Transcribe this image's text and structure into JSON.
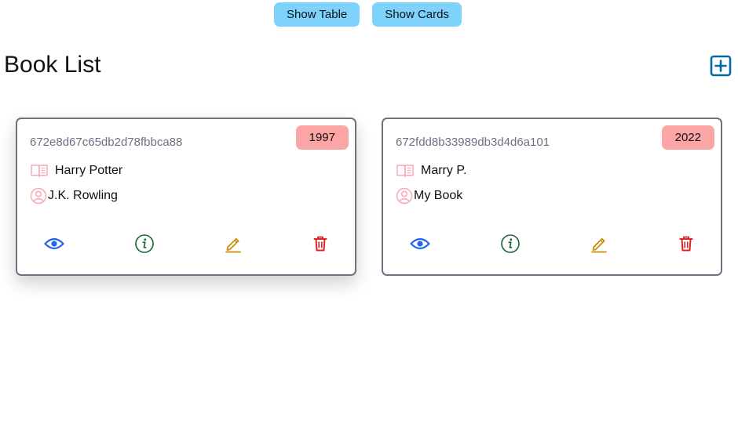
{
  "toolbar": {
    "show_table_label": "Show Table",
    "show_cards_label": "Show Cards"
  },
  "page": {
    "title": "Book List",
    "add_icon": "plus-square-icon"
  },
  "books": [
    {
      "id": "672e8d67c65db2d78fbbca88",
      "year": "1997",
      "title": "Harry Potter",
      "author": "J.K. Rowling"
    },
    {
      "id": "672fdd8b33989db3d4d6a101",
      "year": "2022",
      "title": "Marry P.",
      "author": "My Book"
    }
  ],
  "icons": {
    "title": "book-open-icon",
    "author": "user-circle-icon",
    "view": "eye-icon",
    "info": "info-circle-icon",
    "edit": "pencil-icon",
    "delete": "trash-icon"
  },
  "colors": {
    "toggle_button": "#7dd3fc",
    "year_badge": "#fca5a5",
    "add_icon": "#0369a1",
    "row_icon": "#f9a8b4",
    "view": "#2563eb",
    "info": "#166534",
    "edit": "#ca8a04",
    "delete": "#dc2626"
  }
}
